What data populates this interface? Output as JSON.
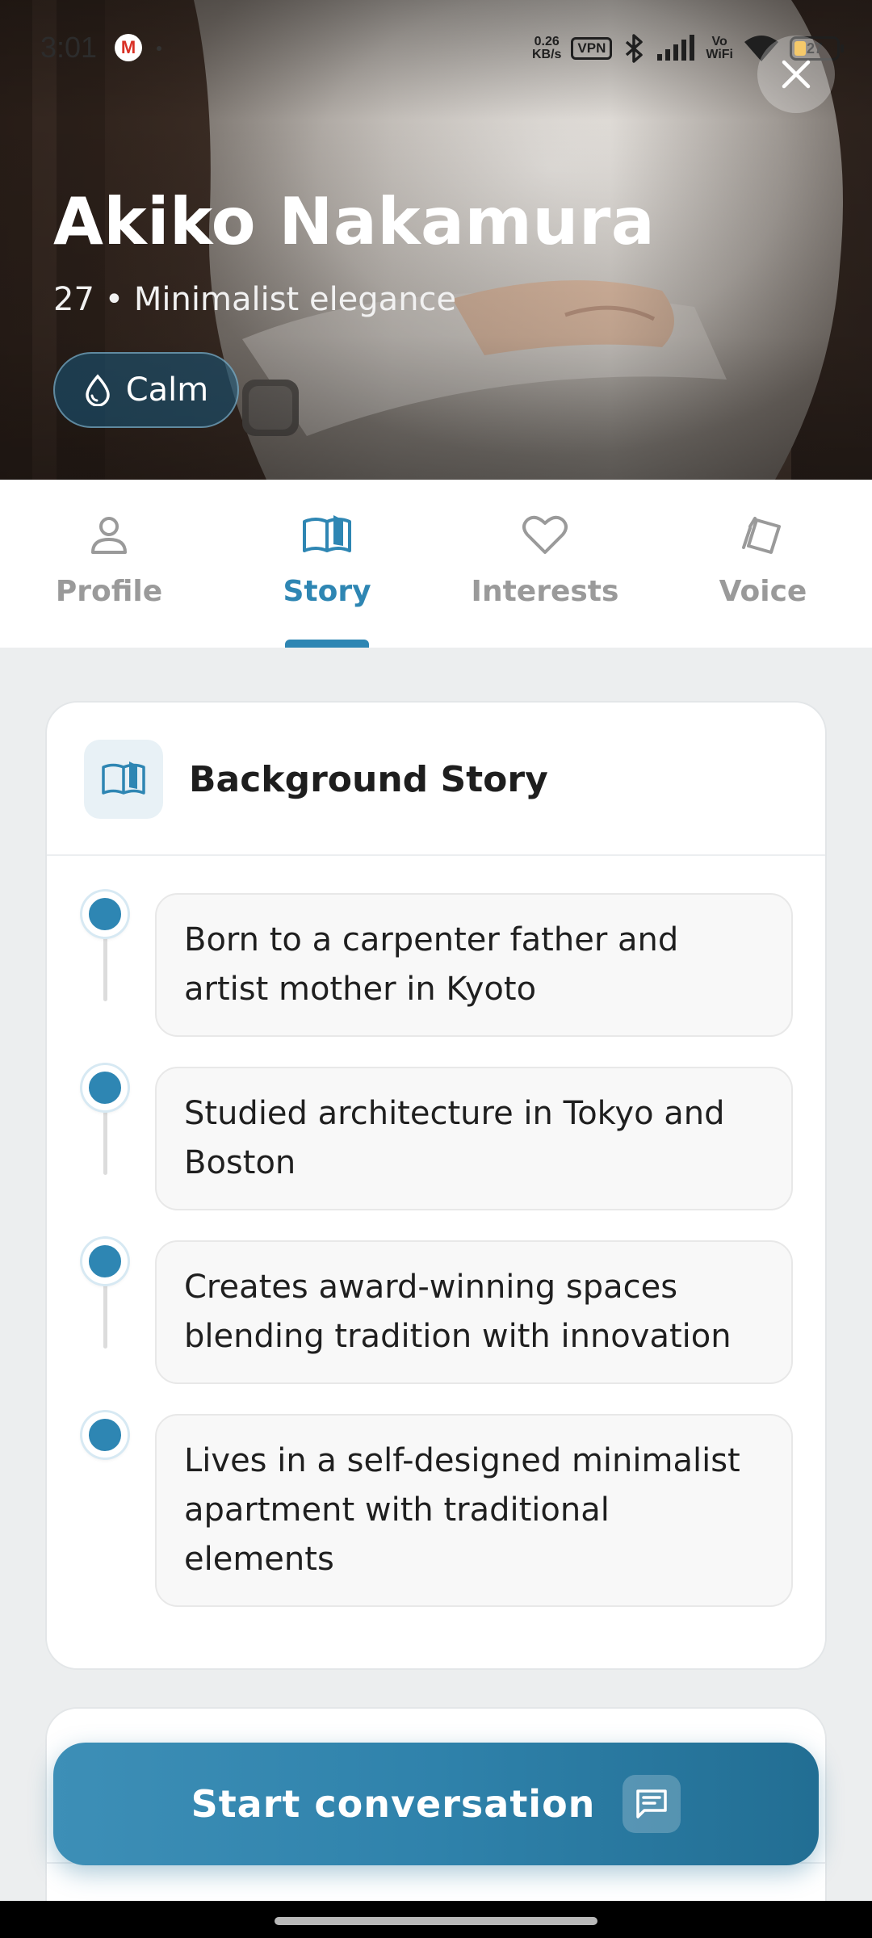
{
  "status_bar": {
    "time": "3:01",
    "net_speed": "0.26\nKB/s",
    "vpn": "VPN",
    "vowifi": "Vo\nWiFi",
    "battery": "27",
    "icons": [
      "gmail-icon",
      "bluetooth-icon",
      "signal-icon",
      "wifi-icon",
      "battery-icon"
    ]
  },
  "hero": {
    "name": "Akiko Nakamura",
    "subtitle": "27 • Minimalist elegance",
    "mood_chip": "Calm",
    "close_icon": "close-icon"
  },
  "tabs": [
    {
      "label": "Profile",
      "icon": "person-icon",
      "active": false
    },
    {
      "label": "Story",
      "icon": "book-icon",
      "active": true
    },
    {
      "label": "Interests",
      "icon": "heart-icon",
      "active": false
    },
    {
      "label": "Voice",
      "icon": "card-icon",
      "active": false
    }
  ],
  "story_card": {
    "title": "Background Story",
    "icon": "book-icon",
    "items": [
      "Born to a carpenter father and artist mother in Kyoto",
      "Studied architecture in Tokyo and Boston",
      "Creates award-winning spaces blending tradition with innovation",
      "Lives in a self-designed minimalist apartment with traditional elements"
    ]
  },
  "cta": {
    "label": "Start conversation",
    "icon": "chat-icon"
  },
  "colors": {
    "accent": "#2e86b3",
    "inactive_tab": "#9a9a9a",
    "background": "#eceeef"
  }
}
